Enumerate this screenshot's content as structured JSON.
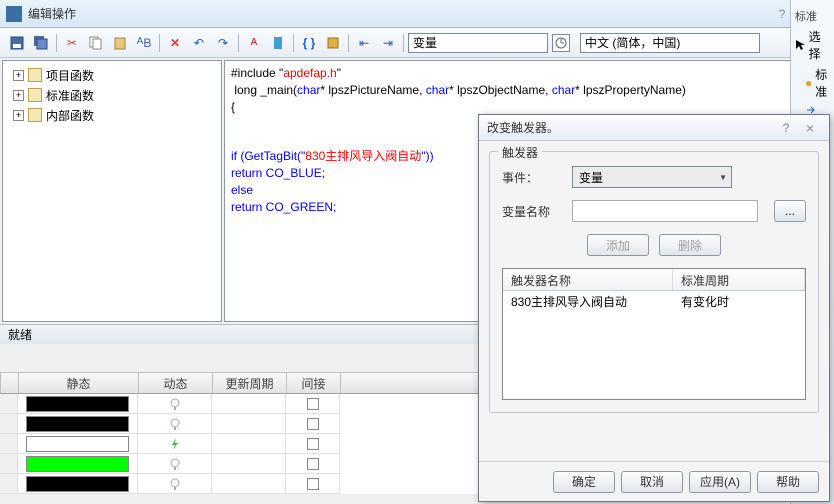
{
  "window": {
    "title": "编辑操作",
    "help_icon": "?",
    "close_icon": "×"
  },
  "toolbar": {
    "combo_var": "变量",
    "combo_lang": "中文 (简体，中国)"
  },
  "tree": {
    "items": [
      "项目函数",
      "标准函数",
      "内部函数"
    ]
  },
  "code": {
    "l1a": "#include \"",
    "l1b": "apdefap.h",
    "l1c": "\"",
    "l2a": " long _main(",
    "l2b": "char",
    "l2c": "* lpszPictureName, ",
    "l2d": "char",
    "l2e": "* lpszObjectName, ",
    "l2f": "char",
    "l2g": "* lpszPropertyName)",
    "l3": "{",
    "l4a": "if (GetTagBit(\"",
    "l4b": "830主排风导入阀自动",
    "l4c": "\"))",
    "l5": "return CO_BLUE;",
    "l6": "else",
    "l7": "return CO_GREEN;"
  },
  "status": {
    "text": "就绪"
  },
  "right": {
    "header": "标准",
    "sel": "选择",
    "std": "标准"
  },
  "grid": {
    "headers": [
      "静态",
      "动态",
      "更新周期",
      "间接"
    ],
    "swatches": [
      "#000000",
      "#000000",
      "#ffffff",
      "#00ff00",
      "#000000"
    ]
  },
  "dialog": {
    "title": "改变触发器。",
    "help_icon": "?",
    "close_icon": "×",
    "legend": "触发器",
    "event_label": "事件：",
    "event_value": "变量",
    "varname_label": "变量名称",
    "dots": "...",
    "add": "添加",
    "del": "删除",
    "col1": "触发器名称",
    "col2": "标准周期",
    "row1c1": "830主排风导入阀自动",
    "row1c2": "有变化时",
    "ok": "确定",
    "cancel": "取消",
    "apply": "应用(A)",
    "help": "帮助"
  }
}
